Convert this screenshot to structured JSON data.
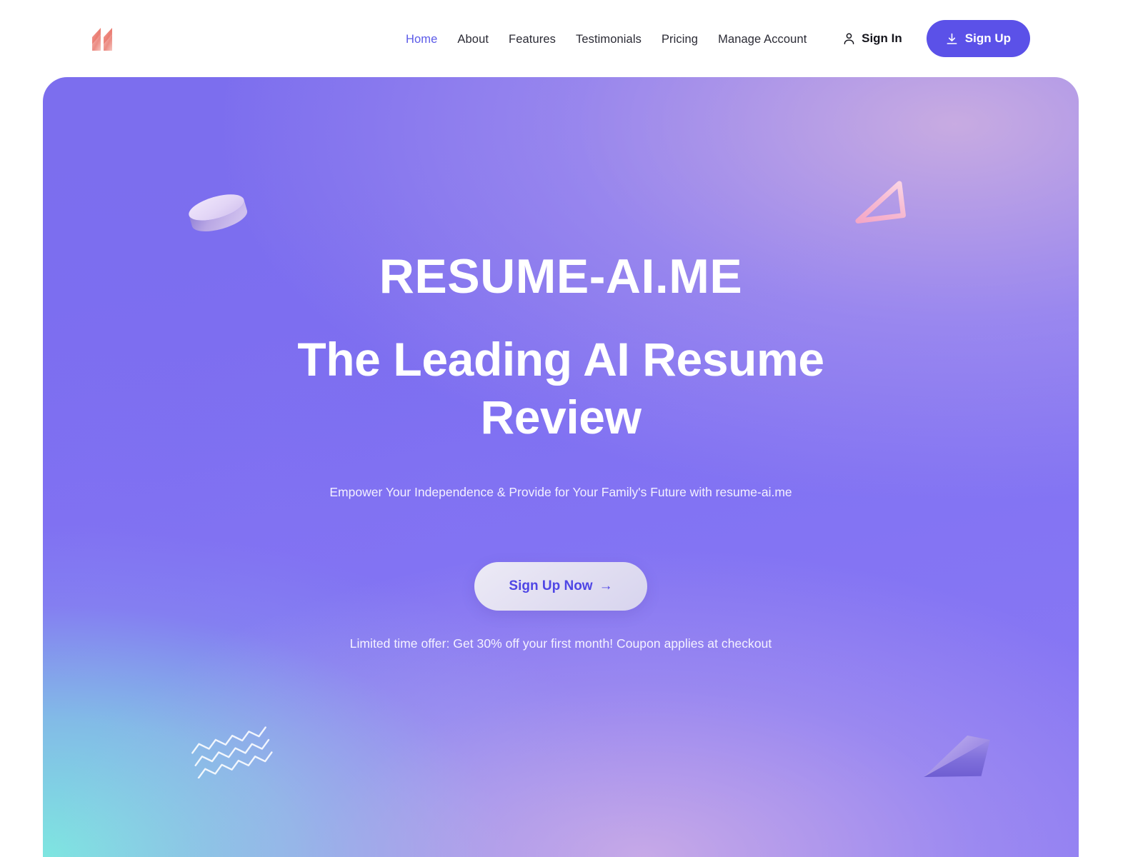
{
  "header": {
    "logo_icon": "resume-ai-lightning-logo",
    "nav": [
      {
        "label": "Home",
        "active": true
      },
      {
        "label": "About",
        "active": false
      },
      {
        "label": "Features",
        "active": false
      },
      {
        "label": "Testimonials",
        "active": false
      },
      {
        "label": "Pricing",
        "active": false
      },
      {
        "label": "Manage Account",
        "active": false
      }
    ],
    "sign_in": {
      "label": "Sign In",
      "icon": "user-icon"
    },
    "sign_up": {
      "label": "Sign Up",
      "icon": "download-icon"
    }
  },
  "hero": {
    "brand": "RESUME-AI.ME",
    "headline": "The Leading AI Resume Review",
    "subheadline": "Empower Your Independence & Provide for Your Family's Future with resume-ai.me",
    "cta": {
      "label": "Sign Up Now",
      "arrow": "→"
    },
    "offer": "Limited time offer: Get 30% off your first month! Coupon applies at checkout",
    "decorations": [
      {
        "name": "disc-3d",
        "shape": "cylinder"
      },
      {
        "name": "triangle-outline",
        "shape": "triangle"
      },
      {
        "name": "cone-3d",
        "shape": "cone"
      },
      {
        "name": "zigzag-lines",
        "shape": "waves"
      }
    ]
  },
  "colors": {
    "accent": "#5b51e8",
    "nav_active": "#5b5ae8",
    "cta_text": "#4f46e5",
    "logo": "#ef8279",
    "hero_purple": "#7b6df1",
    "hero_teal": "#7ee8e0",
    "hero_pink": "#d6b5e4"
  }
}
